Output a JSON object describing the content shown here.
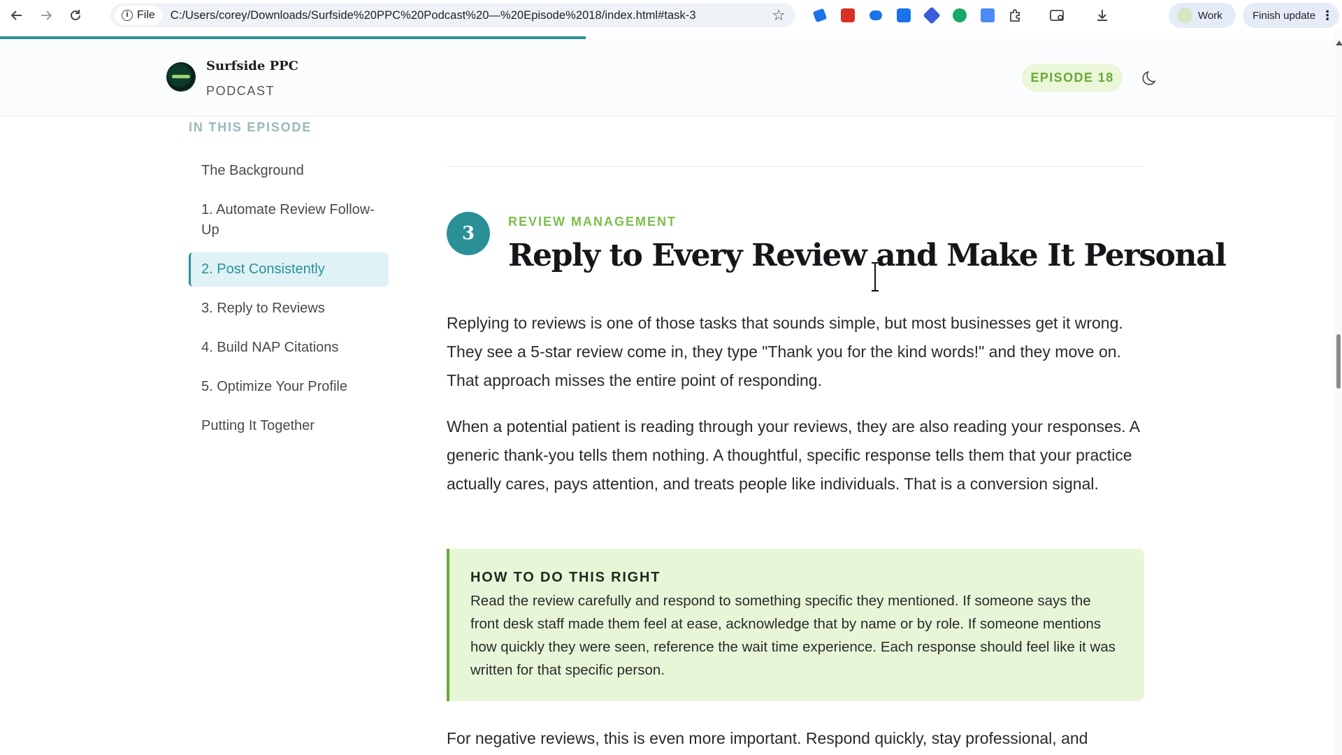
{
  "browser": {
    "file_label": "File",
    "url": "C:/Users/corey/Downloads/Surfside%20PPC%20Podcast%20—%20Episode%2018/index.html#task-3",
    "profile_label": "Work",
    "update_label": "Finish update"
  },
  "header": {
    "brand_name": "Surfside PPC",
    "brand_sub": "PODCAST",
    "episode_badge": "EPISODE 18"
  },
  "toc": {
    "heading": "IN THIS EPISODE",
    "items": [
      {
        "label": "The Background"
      },
      {
        "label": "1. Automate Review Follow-Up"
      },
      {
        "label": "2. Post Consistently"
      },
      {
        "label": "3. Reply to Reviews"
      },
      {
        "label": "4. Build NAP Citations"
      },
      {
        "label": "5. Optimize Your Profile"
      },
      {
        "label": "Putting It Together"
      }
    ],
    "active_index": 2
  },
  "section": {
    "number": "3",
    "eyebrow": "REVIEW MANAGEMENT",
    "title": "Reply to Every Review and Make It Personal",
    "para1": "Replying to reviews is one of those tasks that sounds simple, but most businesses get it wrong. They see a 5-star review come in, they type \"Thank you for the kind words!\" and they move on. That approach misses the entire point of responding.",
    "para2": "When a potential patient is reading through your reviews, they are also reading your responses. A generic thank-you tells them nothing. A thoughtful, specific response tells them that your practice actually cares, pays attention, and treats people like individuals. That is a conversion signal.",
    "callout_title": "HOW TO DO THIS RIGHT",
    "callout_body": "Read the review carefully and respond to something specific they mentioned. If someone says the front desk staff made them feel at ease, acknowledge that by name or by role. If someone mentions how quickly they were seen, reference the wait time experience. Each response should feel like it was written for that specific person.",
    "para3": "For negative reviews, this is even more important. Respond quickly, stay professional, and"
  },
  "colors": {
    "accent_teal": "#2b8f98",
    "accent_green": "#7bbf4a",
    "callout_bg": "#e8f6d8",
    "badge_bg": "#eaf7d8"
  },
  "icons": [
    "back-arrow-icon",
    "forward-arrow-icon",
    "reload-icon",
    "info-icon",
    "star-icon",
    "moon-icon",
    "download-icon",
    "puzzle-icon",
    "kebab-menu-icon"
  ]
}
